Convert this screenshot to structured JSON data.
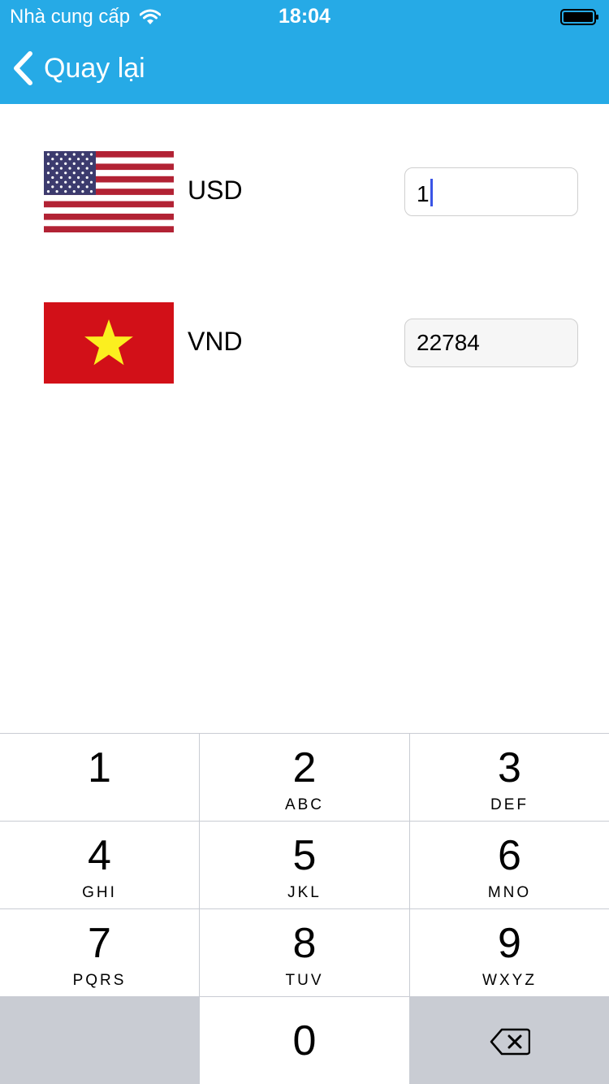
{
  "status_bar": {
    "carrier": "Nhà cung cấp",
    "time": "18:04"
  },
  "nav": {
    "back_label": "Quay lại"
  },
  "currencies": [
    {
      "code": "USD",
      "value": "1"
    },
    {
      "code": "VND",
      "value": "22784"
    }
  ],
  "keypad": {
    "keys": [
      {
        "digit": "1",
        "letters": ""
      },
      {
        "digit": "2",
        "letters": "ABC"
      },
      {
        "digit": "3",
        "letters": "DEF"
      },
      {
        "digit": "4",
        "letters": "GHI"
      },
      {
        "digit": "5",
        "letters": "JKL"
      },
      {
        "digit": "6",
        "letters": "MNO"
      },
      {
        "digit": "7",
        "letters": "PQRS"
      },
      {
        "digit": "8",
        "letters": "TUV"
      },
      {
        "digit": "9",
        "letters": "WXYZ"
      },
      {
        "digit": "0",
        "letters": ""
      }
    ]
  },
  "colors": {
    "header": "#26aae6",
    "caret": "#3a54e6",
    "keypad_bg": "#c9ccd3"
  }
}
